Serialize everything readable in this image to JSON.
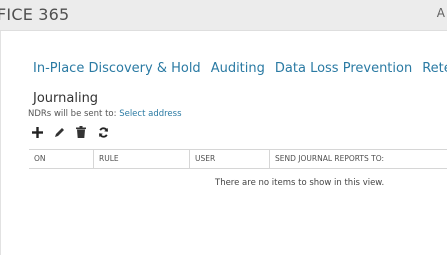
{
  "header": {
    "app_title": "FICE 365",
    "right_text": "A"
  },
  "tabs": [
    {
      "label": "In-Place Discovery & Hold"
    },
    {
      "label": "Auditing"
    },
    {
      "label": "Data Loss Prevention"
    },
    {
      "label": "Retention Pol"
    }
  ],
  "section": {
    "title": "Journaling",
    "ndr_prefix": "NDRs will be sent to: ",
    "ndr_link": "Select address"
  },
  "toolbar": {
    "icons": [
      "add-icon",
      "edit-icon",
      "delete-icon",
      "refresh-icon"
    ]
  },
  "grid": {
    "columns": [
      "ON",
      "RULE",
      "USER",
      "SEND JOURNAL REPORTS TO:"
    ],
    "empty_message": "There are no items to show in this view."
  },
  "colors": {
    "link": "#2a7aa3",
    "header_bg": "#ececec"
  }
}
